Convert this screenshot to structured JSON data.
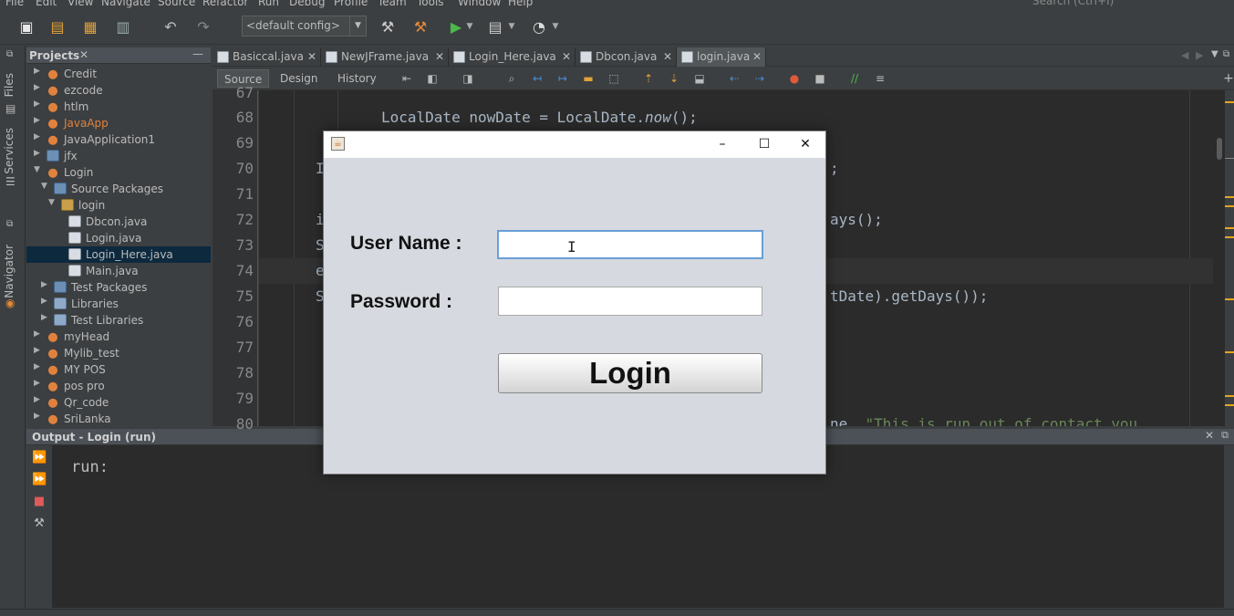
{
  "menu": {
    "items": [
      "File",
      "Edit",
      "View",
      "Navigate",
      "Source",
      "Refactor",
      "Run",
      "Debug",
      "Profile",
      "Team",
      "Tools",
      "Window",
      "Help"
    ],
    "search_placeholder": "Search (Ctrl+I)"
  },
  "toolbar": {
    "config_value": "<default config>"
  },
  "left_strip": {
    "tabs": [
      "Files",
      "Services",
      "Navigator"
    ]
  },
  "projects": {
    "title": "Projects",
    "items": [
      {
        "label": "Credit",
        "icon": "project-cup-icon"
      },
      {
        "label": "ezcode",
        "icon": "project-cup-icon"
      },
      {
        "label": "htlm",
        "icon": "project-cup-icon"
      },
      {
        "label": "JavaApp",
        "icon": "project-cup-icon",
        "color": "#e0823d"
      },
      {
        "label": "JavaApplication1",
        "icon": "project-cup-icon"
      },
      {
        "label": "jfx",
        "icon": "fx-project-icon"
      },
      {
        "label": "Login",
        "icon": "project-cup-icon"
      },
      {
        "label": "Source Packages",
        "icon": "source-packages-icon"
      },
      {
        "label": "login",
        "icon": "package-icon"
      },
      {
        "label": "Dbcon.java",
        "icon": "java-file-icon"
      },
      {
        "label": "Login.java",
        "icon": "java-form-icon"
      },
      {
        "label": "Login_Here.java",
        "icon": "java-form-icon"
      },
      {
        "label": "Main.java",
        "icon": "java-file-icon"
      },
      {
        "label": "Test Packages",
        "icon": "test-packages-icon"
      },
      {
        "label": "Libraries",
        "icon": "libraries-icon"
      },
      {
        "label": "Test Libraries",
        "icon": "libraries-icon"
      },
      {
        "label": "myHead",
        "icon": "project-cup-icon"
      },
      {
        "label": "Mylib_test",
        "icon": "project-cup-icon"
      },
      {
        "label": "MY POS",
        "icon": "project-cup-icon"
      },
      {
        "label": "pos pro",
        "icon": "project-cup-icon"
      },
      {
        "label": "Qr_code",
        "icon": "project-cup-icon"
      },
      {
        "label": "SriLanka",
        "icon": "project-cup-icon"
      }
    ]
  },
  "editor": {
    "tabs": [
      "Basiccal.java",
      "NewJFrame.java",
      "Login_Here.java",
      "Dbcon.java",
      "login.java"
    ],
    "modes": [
      "Source",
      "Design",
      "History"
    ],
    "line_numbers": [
      "67",
      "68",
      "69",
      "70",
      "71",
      "72",
      "73",
      "74",
      "75",
      "76",
      "77",
      "78",
      "79",
      "80"
    ],
    "code": {
      "l68a": "LocalDate nowDate = LocalDate.",
      "l68b": "now",
      "l68c": "();",
      "l70a": "I",
      "l70b": ";",
      "l72a": "i",
      "l72b": "ays();",
      "l73": "S",
      "l74": "e",
      "l75a": "S",
      "l75b": "tDate).getDays());",
      "l80a": "ne, ",
      "l80b": "\"This is run out of contact you"
    }
  },
  "output": {
    "title": "Output - Login (run)",
    "text": "run:"
  },
  "dialog": {
    "user_label": "User Name :",
    "password_label": "Password :",
    "user_value": "",
    "password_value": "",
    "login_label": "Login",
    "minimize": "–",
    "maximize": "☐",
    "close": "✕"
  }
}
